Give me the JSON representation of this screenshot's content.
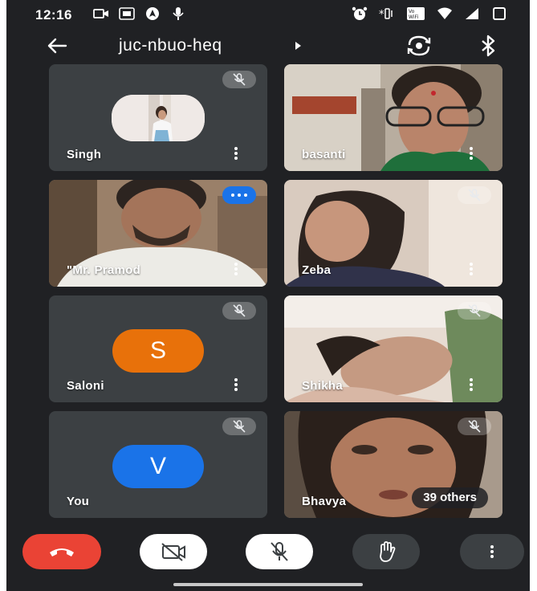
{
  "status_bar": {
    "time": "12:16",
    "left_icons": [
      "video-call-icon",
      "screen-record-icon",
      "navigation-app-icon",
      "mic-icon"
    ],
    "right_icons": [
      "alarm-icon",
      "vibrate-icon",
      "volte-wifi-icon",
      "wifi-icon",
      "signal-icon",
      "battery-icon"
    ]
  },
  "header": {
    "meeting_code": "juc-nbuo-heq",
    "icons": [
      "back-arrow-icon",
      "chevron-right-icon",
      "switch-camera-icon",
      "bluetooth-icon"
    ]
  },
  "participants": [
    {
      "name": "Singh",
      "type": "photo-avatar",
      "muted": true
    },
    {
      "name": "basanti",
      "type": "video",
      "muted": false
    },
    {
      "name": "\"Mr. Pramod",
      "type": "video",
      "speaking": true
    },
    {
      "name": "Zeba",
      "type": "video",
      "muted": true
    },
    {
      "name": "Saloni",
      "type": "letter-avatar",
      "initial": "S",
      "avatar_color": "#e8710a",
      "muted": true
    },
    {
      "name": "Shikha",
      "type": "video",
      "muted": true
    },
    {
      "name": "You",
      "type": "letter-avatar",
      "initial": "V",
      "avatar_color": "#1a73e8",
      "muted": true
    },
    {
      "name": "Bhavya",
      "type": "video",
      "muted": true
    }
  ],
  "others_count_label": "39 others",
  "controls": {
    "icons": [
      "end-call-icon",
      "camera-off-icon",
      "mic-off-icon",
      "raise-hand-icon",
      "more-vert-icon"
    ],
    "end_color": "#ea4335"
  },
  "colors": {
    "background": "#202124",
    "tile": "#3c4043",
    "speaking": "#1a73e8"
  }
}
